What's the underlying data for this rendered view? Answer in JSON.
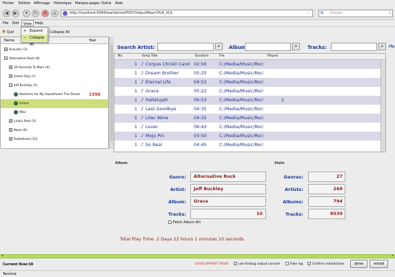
{
  "browser": {
    "menu": [
      "Fichier",
      "Edition",
      "Affichage",
      "Historique",
      "Marque-pages",
      "Outils",
      "Aide"
    ],
    "url": "http://localhost:6394/wa/rdemo/POD?OutputMap=DUA_XUL",
    "search_placeholder": "Google",
    "search_engine_letter": "G"
  },
  "app": {
    "menu": [
      "File",
      "Edit",
      "View",
      "Help"
    ],
    "toolbar": {
      "quit": "Quit",
      "collapse": "Collapse All"
    },
    "view_menu": [
      "Expand All",
      "Collapse All"
    ],
    "tree": {
      "col_name": "Name",
      "col_year": "Year",
      "rows": [
        {
          "label": "Acoustic (3)",
          "level": 0,
          "kind": "plus"
        },
        {
          "label": "Alternative Rock (8)",
          "level": 0,
          "kind": "minus"
        },
        {
          "label": "30 Seconds To Mars (4)",
          "level": 1,
          "kind": "plus"
        },
        {
          "label": "Green Day (1)",
          "level": 1,
          "kind": "plus"
        },
        {
          "label": "Jeff Buckley (3)",
          "level": 1,
          "kind": "minus"
        },
        {
          "label": "Sketches for My Sweetheart The Drunk",
          "year": "1998",
          "level": 2,
          "kind": "cd"
        },
        {
          "label": "Grace",
          "level": 2,
          "kind": "cd",
          "selected": true
        },
        {
          "label": "Misc",
          "level": 2,
          "kind": "cd"
        },
        {
          "label": "Linkin Park (5)",
          "level": 1,
          "kind": "plus"
        },
        {
          "label": "Muse (6)",
          "level": 1,
          "kind": "plus"
        },
        {
          "label": "Radiohead (12)",
          "level": 1,
          "kind": "plus"
        }
      ]
    },
    "search": {
      "artist_label": "Search Artist:",
      "albums_label": "Albums:",
      "tracks_label": "Tracks:",
      "truncated": "iTu"
    },
    "grid": {
      "headers": [
        "No.",
        "Song Title",
        "Duration",
        "File",
        "Played"
      ],
      "rows": [
        {
          "no": "1",
          "title": "Corpus Christi Carol",
          "duration": "02:56",
          "file": "C:/Media/Music/Rock/",
          "played": ""
        },
        {
          "no": "1",
          "title": "Dream Brother",
          "duration": "05:25",
          "file": "C:/Media/Music/Rock/",
          "played": ""
        },
        {
          "no": "1",
          "title": "Eternal Life",
          "duration": "04:52",
          "file": "C:/Media/Music/Rock/",
          "played": ""
        },
        {
          "no": "1",
          "title": "Grace",
          "duration": "05:22",
          "file": "C:/Media/Music/Rock/",
          "played": ""
        },
        {
          "no": "1",
          "title": "Hallelujah",
          "duration": "06:53",
          "file": "C:/Media/Music/Rock/",
          "played": "2"
        },
        {
          "no": "1",
          "title": "Last Goodbye",
          "duration": "04:35",
          "file": "C:/Media/Music/Rock/",
          "played": ""
        },
        {
          "no": "1",
          "title": "Lilac Wine",
          "duration": "04:32",
          "file": "C:/Media/Music/Rock/",
          "played": ""
        },
        {
          "no": "1",
          "title": "Lover",
          "duration": "06:43",
          "file": "C:/Media/Music/Rock/",
          "played": ""
        },
        {
          "no": "1",
          "title": "Mojo Pin",
          "duration": "03:50",
          "file": "C:/Media/Music/Rock/",
          "played": ""
        },
        {
          "no": "1",
          "title": "So Real",
          "duration": "04:45",
          "file": "C:/Media/Music/Rock/",
          "played": ""
        }
      ]
    },
    "album": {
      "section": "Album",
      "genre_label": "Genre:",
      "genre": "Alternative Rock",
      "artist_label": "Artist:",
      "artist": "Jeff Buckley",
      "album_label": "Album:",
      "album": "Grace",
      "tracks_label": "Tracks:",
      "tracks": "10",
      "fetch_art": "Fetch Album Art"
    },
    "stats": {
      "section": "Stats",
      "genres_label": "Genres:",
      "genres": "27",
      "artists_label": "Artists:",
      "artists": "268",
      "albums_label": "Albums:",
      "albums": "794",
      "tracks_label": "Tracks:",
      "tracks": "8539"
    },
    "playtime": "Total Play Time: 2 Days 22 hours 1 minutes 10 seconds",
    "status": {
      "current_row": "Current Row:18",
      "dev_mode": "DEVELOPMENT MODE",
      "use_firebug": "use firebug output console",
      "fake_lag": "Fake lag",
      "confirm_reload": "Confirm reload/close",
      "btn_tree": "qtree",
      "btn_reload": "reload"
    },
    "bottom": "Terminé"
  },
  "colors": {
    "accent_green": "#ccdf7c",
    "year_red": "#c0392b",
    "field_red": "#8b1a1a",
    "label_blue": "#1a3a9a"
  }
}
